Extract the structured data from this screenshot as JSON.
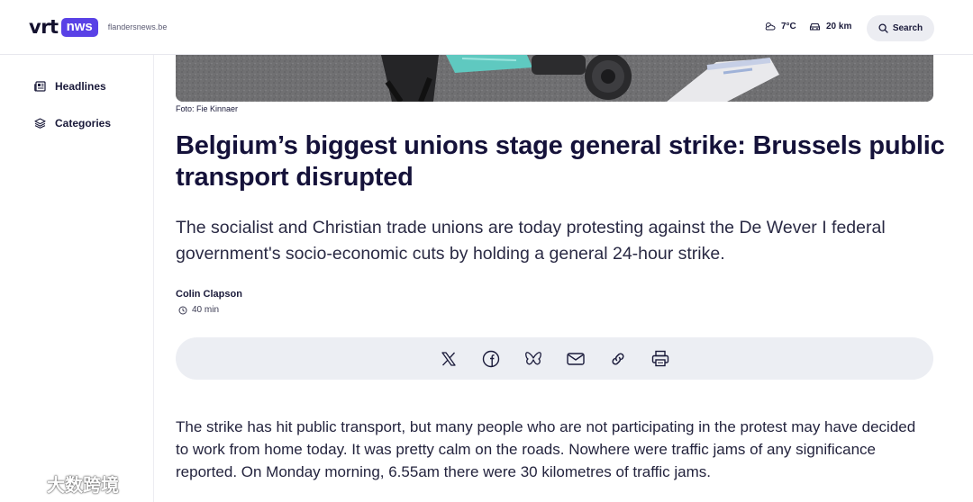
{
  "header": {
    "logo_vrt": "vrt",
    "logo_news": "nws",
    "domain": "flandersnews.be",
    "weather": "7°C",
    "traffic": "20 km",
    "search_label": "Search"
  },
  "sidebar": {
    "items": [
      {
        "label": "Headlines",
        "icon": "newspaper-icon"
      },
      {
        "label": "Categories",
        "icon": "layers-icon"
      }
    ]
  },
  "article": {
    "photo_caption": "Foto: Fie Kinnaer",
    "title": "Belgium’s biggest unions stage general strike: Brussels public transport disrupted",
    "lead": "The socialist and Christian trade unions are today protesting against the De Wever I federal government's socio-economic cuts by holding a general 24-hour strike.",
    "author": "Colin Clapson",
    "time": "40 min",
    "share_icons": [
      "x-icon",
      "facebook-icon",
      "bluesky-icon",
      "mail-icon",
      "link-icon",
      "print-icon"
    ],
    "body": "The strike has hit public transport, but many people who are not participating in the protest may have decided to work from home today.  It was pretty calm on the roads.  Nowhere were traffic jams of any significance reported. On Monday morning, 6.55am there were 30 kilometres of traffic jams."
  },
  "watermark": "大数跨境",
  "colors": {
    "brand": "#5941e6",
    "text": "#15123a",
    "share_bar": "#eceef3"
  }
}
